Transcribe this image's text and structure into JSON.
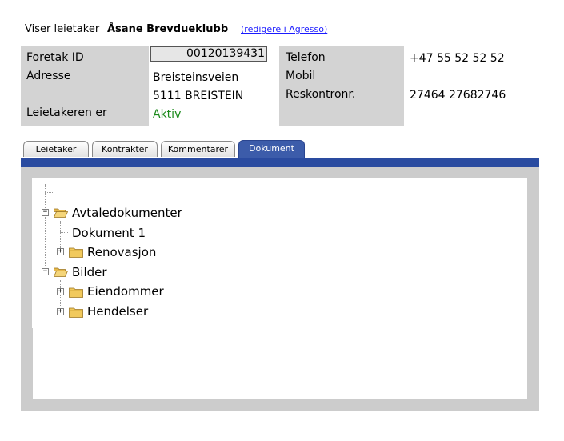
{
  "header": {
    "label": "Viser leietaker",
    "tenant_name": "Åsane Brevdueklubb",
    "edit_link": "(redigere i Agresso)"
  },
  "fields": {
    "company_id_label": "Foretak ID",
    "company_id_value": "00120139431",
    "address_label": "Adresse",
    "address_line1": "Breisteinsveien",
    "address_line2": "5111 BREISTEIN",
    "status_label": "Leietakeren er",
    "status_value": "Aktiv",
    "phone_label": "Telefon",
    "phone_value": "+47 55 52 52 52",
    "mobile_label": "Mobil",
    "mobile_value": "",
    "account_label": "Reskontronr.",
    "account_value": "27464 27682746"
  },
  "tabs": [
    {
      "label": "Leietaker",
      "active": false
    },
    {
      "label": "Kontrakter",
      "active": false
    },
    {
      "label": "Kommentarer",
      "active": false
    },
    {
      "label": "Dokument",
      "active": true
    }
  ],
  "tree": {
    "root": {
      "label": "Avtaledokumenter",
      "expanded": true,
      "children": [
        {
          "label": "Dokument 1"
        },
        {
          "label": "Renovasjon",
          "expanded": false
        }
      ]
    },
    "root2": {
      "label": "Bilder",
      "expanded": true,
      "children": [
        {
          "label": "Eiendommer",
          "expanded": false
        },
        {
          "label": "Hendelser",
          "expanded": false
        }
      ]
    }
  },
  "colors": {
    "tab_active": "#3c5caa",
    "tab_strip": "#2a4ba0",
    "status_active": "#1a8a1a",
    "link": "#1a1aff",
    "panel_bg": "#d3d3d3"
  },
  "icons": {
    "folder_open": "folder-open-icon",
    "folder_closed": "folder-icon",
    "expand": "expand-plus-icon",
    "collapse": "collapse-minus-icon"
  }
}
